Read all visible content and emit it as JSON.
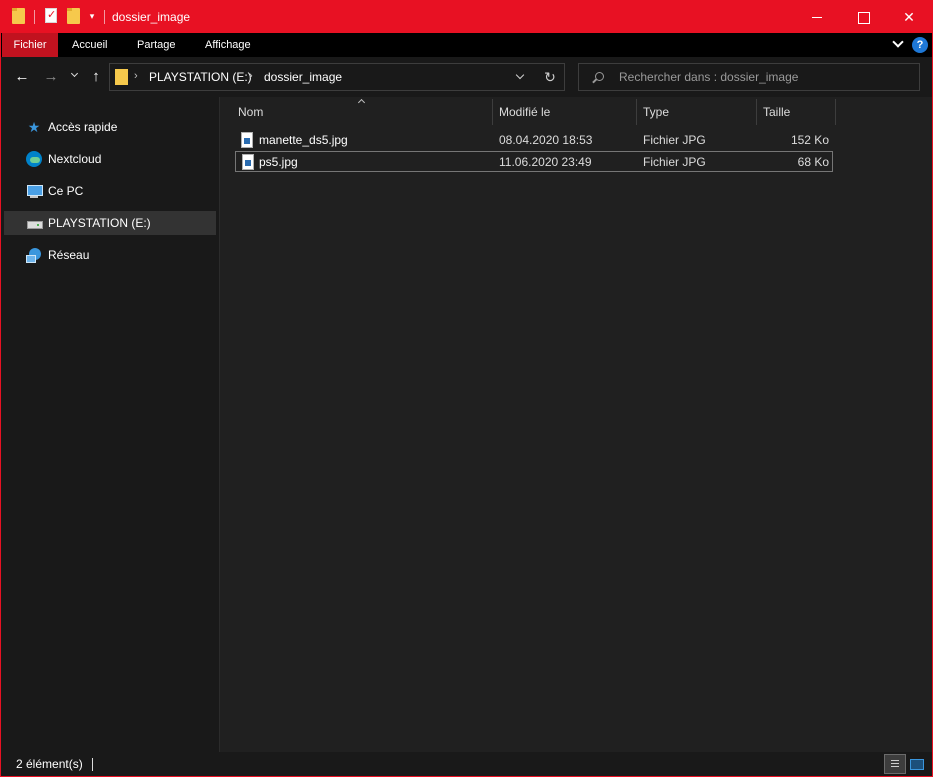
{
  "window": {
    "title": "dossier_image",
    "minimize": "—",
    "maximize": "",
    "close": "✕"
  },
  "quick_access": {
    "dropdown": "▾"
  },
  "ribbon": {
    "tabs": [
      {
        "label": "Fichier",
        "active": true
      },
      {
        "label": "Accueil"
      },
      {
        "label": "Partage"
      },
      {
        "label": "Affichage"
      }
    ],
    "help": "?"
  },
  "nav": {
    "back": "←",
    "forward": "→",
    "up": "↑",
    "breadcrumb": [
      "PLAYSTATION (E:)",
      "dossier_image"
    ],
    "crumb_separator": "›",
    "refresh": "↻",
    "search_placeholder": "Rechercher dans : dossier_image"
  },
  "sidebar": {
    "items": [
      {
        "label": "Accès rapide",
        "icon": "star-icon"
      },
      {
        "label": "Nextcloud",
        "icon": "nextcloud-icon"
      },
      {
        "label": "Ce PC",
        "icon": "computer-icon"
      },
      {
        "label": "PLAYSTATION (E:)",
        "icon": "drive-icon",
        "selected": true
      },
      {
        "label": "Réseau",
        "icon": "network-icon"
      }
    ],
    "star_glyph": "★"
  },
  "file_list": {
    "columns": [
      "Nom",
      "Modifié le",
      "Type",
      "Taille"
    ],
    "rows": [
      {
        "name": "manette_ds5.jpg",
        "modified": "08.04.2020 18:53",
        "type": "Fichier JPG",
        "size": "152 Ko"
      },
      {
        "name": "ps5.jpg",
        "modified": "11.06.2020 23:49",
        "type": "Fichier JPG",
        "size": "68 Ko",
        "focused": true
      }
    ]
  },
  "status": {
    "count": "2 élément(s)"
  },
  "colors": {
    "accent": "#e81123",
    "ribbon_active": "#c1121f",
    "background": "#191919",
    "content_background": "#202020"
  }
}
